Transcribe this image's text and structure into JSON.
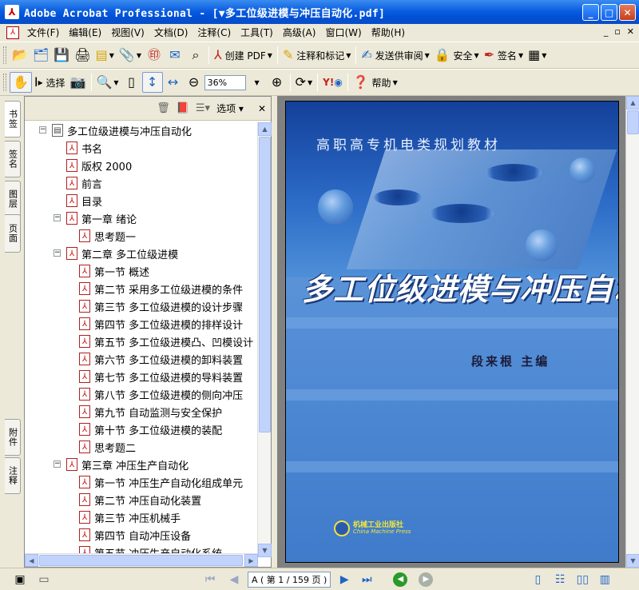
{
  "window": {
    "title": "Adobe Acrobat Professional - [▼多工位级进模与冲压自动化.pdf]",
    "minimize": "_",
    "maximize": "□",
    "close": "✕"
  },
  "menu": {
    "items": [
      "文件(F)",
      "编辑(E)",
      "视图(V)",
      "文档(D)",
      "注释(C)",
      "工具(T)",
      "高级(A)",
      "窗口(W)",
      "帮助(H)"
    ],
    "mdi_min": "_",
    "mdi_restore": "▫",
    "mdi_close": "✕"
  },
  "toolbar1": {
    "create_pdf": "创建 PDF",
    "comment": "注释和标记",
    "review": "发送供审阅",
    "security": "安全",
    "sign": "签名"
  },
  "toolbar2": {
    "select": "选择",
    "zoom": "36%",
    "help": "帮助"
  },
  "side_tabs": {
    "bookmarks": "书签",
    "signatures": "签名",
    "layers": "图层",
    "pages": "页面",
    "attachments": "附件",
    "comments": "注释"
  },
  "bookmarks_panel": {
    "options": "选项",
    "close": "✕",
    "items": [
      {
        "label": "多工位级进模与冲压自动化",
        "level": 0,
        "expander": "−",
        "icon": "doc"
      },
      {
        "label": "书名",
        "level": 1,
        "expander": "",
        "icon": "pdf"
      },
      {
        "label": "版权 2000",
        "level": 1,
        "expander": "",
        "icon": "pdf"
      },
      {
        "label": "前言",
        "level": 1,
        "expander": "",
        "icon": "pdf"
      },
      {
        "label": "目录",
        "level": 1,
        "expander": "",
        "icon": "pdf"
      },
      {
        "label": "第一章 绪论",
        "level": 1,
        "expander": "−",
        "icon": "pdf"
      },
      {
        "label": "思考题一",
        "level": 2,
        "expander": "",
        "icon": "pdf"
      },
      {
        "label": "第二章 多工位级进模",
        "level": 1,
        "expander": "−",
        "icon": "pdf"
      },
      {
        "label": "第一节 概述",
        "level": 2,
        "expander": "",
        "icon": "pdf"
      },
      {
        "label": "第二节 采用多工位级进模的条件",
        "level": 2,
        "expander": "",
        "icon": "pdf"
      },
      {
        "label": "第三节 多工位级进模的设计步骤",
        "level": 2,
        "expander": "",
        "icon": "pdf"
      },
      {
        "label": "第四节 多工位级进模的排样设计",
        "level": 2,
        "expander": "",
        "icon": "pdf"
      },
      {
        "label": "第五节 多工位级进模凸、凹模设计",
        "level": 2,
        "expander": "",
        "icon": "pdf"
      },
      {
        "label": "第六节 多工位级进模的卸料装置",
        "level": 2,
        "expander": "",
        "icon": "pdf"
      },
      {
        "label": "第七节 多工位级进模的导料装置",
        "level": 2,
        "expander": "",
        "icon": "pdf"
      },
      {
        "label": "第八节 多工位级进模的侧向冲压",
        "level": 2,
        "expander": "",
        "icon": "pdf"
      },
      {
        "label": "第九节 自动监测与安全保护",
        "level": 2,
        "expander": "",
        "icon": "pdf"
      },
      {
        "label": "第十节 多工位级进模的装配",
        "level": 2,
        "expander": "",
        "icon": "pdf"
      },
      {
        "label": "思考题二",
        "level": 2,
        "expander": "",
        "icon": "pdf"
      },
      {
        "label": "第三章 冲压生产自动化",
        "level": 1,
        "expander": "−",
        "icon": "pdf"
      },
      {
        "label": "第一节 冲压生产自动化组成单元",
        "level": 2,
        "expander": "",
        "icon": "pdf"
      },
      {
        "label": "第二节 冲压自动化装置",
        "level": 2,
        "expander": "",
        "icon": "pdf"
      },
      {
        "label": "第三节 冲压机械手",
        "level": 2,
        "expander": "",
        "icon": "pdf"
      },
      {
        "label": "第四节 自动冲压设备",
        "level": 2,
        "expander": "",
        "icon": "pdf"
      },
      {
        "label": "第五节 冲压生产自动化系统",
        "level": 2,
        "expander": "",
        "icon": "pdf"
      }
    ]
  },
  "cover": {
    "series": "高职高专机电类规划教材",
    "title": "多工位级进模与冲压自动化",
    "author": "段来根  主编",
    "publisher_cn": "机械工业出版社",
    "publisher_en": "China Machine Press"
  },
  "status": {
    "page_indicator": "A ( 第 1 / 159 页 )"
  },
  "colors": {
    "titlebar": "#0a5ee0",
    "cover_blue": "#1f52a8",
    "pdf_red": "#c3241e"
  }
}
